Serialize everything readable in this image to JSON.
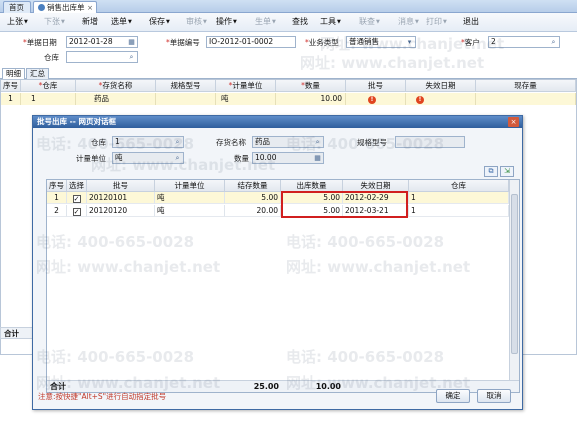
{
  "tabs": {
    "home": "首页",
    "sales_out": "销售出库单",
    "close": "×"
  },
  "toolbar": {
    "items": [
      "上张",
      "下张",
      "新增",
      "选单",
      "保存",
      "审核",
      "操作",
      "生单",
      "查找",
      "工具",
      "联查",
      "消息",
      "打印",
      "退出"
    ]
  },
  "header": {
    "labels": {
      "date": "单据日期",
      "number": "单据编号",
      "biz_type": "业务类型",
      "customer": "客户",
      "warehouse": "仓库"
    },
    "date_value": "2012-01-28",
    "number_value": "IO-2012-01-0002",
    "biz_type_value": "普通销售",
    "customer_value": "2",
    "warehouse_value": ""
  },
  "detail_tabs": [
    "明细",
    "汇总"
  ],
  "grid": {
    "columns": [
      "序号",
      "仓库",
      "存货名称",
      "规格型号",
      "计量单位",
      "数量",
      "批号",
      "失效日期",
      "现存量"
    ],
    "rows": [
      {
        "seq": "1",
        "warehouse": "1",
        "item": "药品",
        "spec": "",
        "unit": "吨",
        "qty": "10.00",
        "batch": "!",
        "expire": "!",
        "stock": ""
      }
    ],
    "total_label": "合计"
  },
  "watermark": {
    "phone": "电话: 400-665-0028",
    "site": "网址: www.chanjet.net"
  },
  "dialog": {
    "title": "批号出库 -- 网页对话框",
    "close": "×",
    "labels": {
      "warehouse": "仓库",
      "item_name": "存货名称",
      "spec": "规格型号",
      "unit": "计量单位",
      "qty": "数量"
    },
    "values": {
      "warehouse": "1",
      "item_name": "药品",
      "spec": "",
      "unit": "吨",
      "qty": "10.00"
    },
    "columns": [
      "序号",
      "选择",
      "批号",
      "计量单位",
      "结存数量",
      "出库数量",
      "失效日期",
      "仓库"
    ],
    "rows": [
      {
        "seq": "1",
        "selected": "✓",
        "batch": "20120101",
        "unit": "吨",
        "balance": "5.00",
        "out_qty": "5.00",
        "expire": "2012-02-29",
        "warehouse": "1"
      },
      {
        "seq": "2",
        "selected": "✓",
        "batch": "20120120",
        "unit": "吨",
        "balance": "20.00",
        "out_qty": "5.00",
        "expire": "2012-03-21",
        "warehouse": "1"
      }
    ],
    "total_label": "合计",
    "total_balance": "25.00",
    "total_out": "10.00",
    "note": "注意:按快捷\"Alt+S\"进行自动指定批号",
    "ok": "确定",
    "cancel": "取消"
  }
}
